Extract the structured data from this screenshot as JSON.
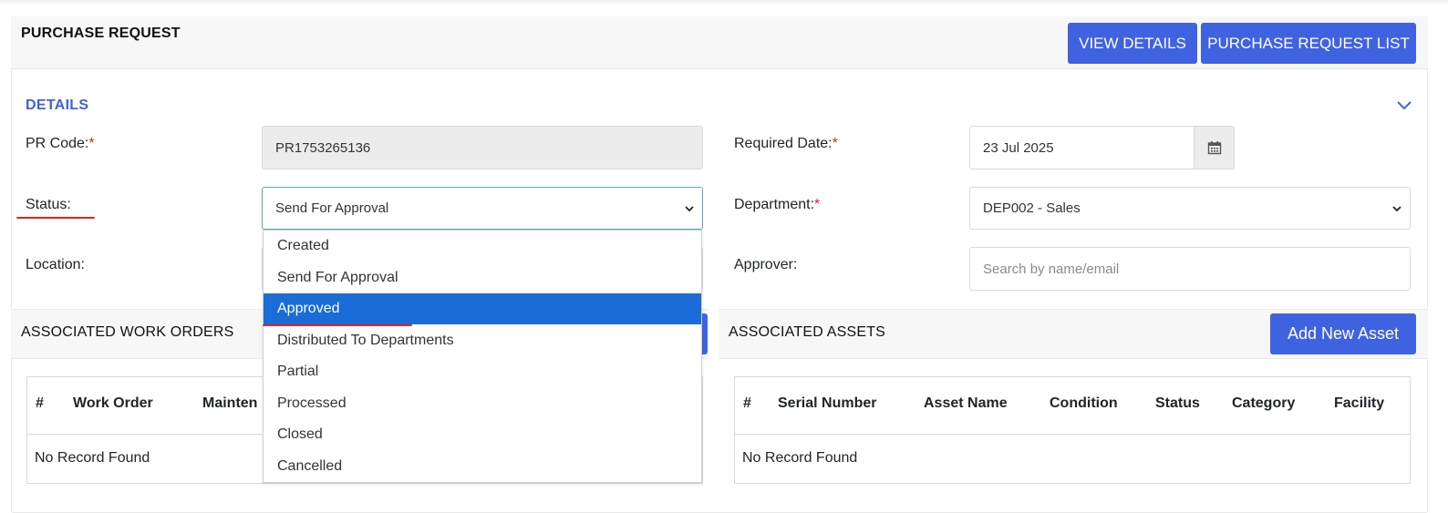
{
  "header": {
    "title": "PURCHASE REQUEST",
    "view_details_label": "VIEW DETAILS",
    "pr_list_label": "PURCHASE REQUEST LIST"
  },
  "details": {
    "section_title": "DETAILS",
    "pr_code": {
      "label": "PR Code:",
      "required_mark": "*",
      "value": "PR1753265136"
    },
    "required_date": {
      "label": "Required Date:",
      "required_mark": "*",
      "value": "23 Jul 2025"
    },
    "status": {
      "label": "Status:",
      "value": "Send For Approval"
    },
    "department": {
      "label": "Department:",
      "required_mark": "*",
      "value": "DEP002 - Sales"
    },
    "location": {
      "label": "Location:"
    },
    "approver": {
      "label": "Approver:",
      "placeholder": "Search by name/email"
    }
  },
  "status_dropdown": {
    "options": [
      "Created",
      "Send For Approval",
      "Approved",
      "Distributed To Departments",
      "Partial",
      "Processed",
      "Closed",
      "Cancelled"
    ],
    "highlighted": "Approved"
  },
  "work_orders": {
    "title": "ASSOCIATED WORK ORDERS",
    "columns": [
      "#",
      "Work Order",
      "Mainten"
    ],
    "empty_text": "No Record Found"
  },
  "assets": {
    "title": "ASSOCIATED ASSETS",
    "add_button_label": "Add New Asset",
    "columns": [
      "#",
      "Serial Number",
      "Asset Name",
      "Condition",
      "Status",
      "Category",
      "Facility"
    ],
    "empty_text": "No Record Found"
  },
  "colors": {
    "primary": "#3f63e0",
    "selected_option": "#1a6cd8",
    "required": "#e02424",
    "annotation_underline": "#e02424"
  }
}
